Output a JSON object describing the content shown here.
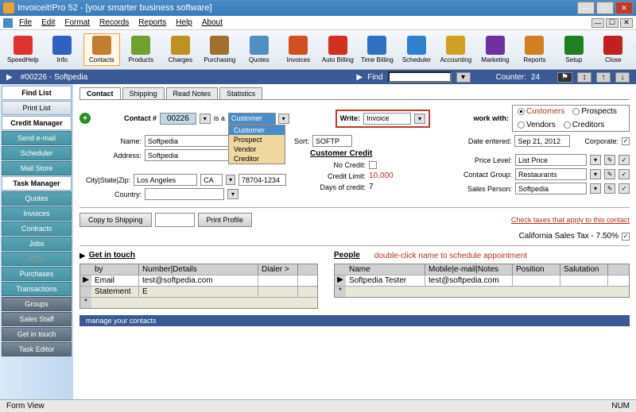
{
  "title": "Invoiceit!Pro 52 - [your smarter business software]",
  "menu": [
    "File",
    "Edit",
    "Format",
    "Records",
    "Reports",
    "Help",
    "About"
  ],
  "toolbar": [
    {
      "label": "SpeedHelp",
      "color": "#e03030"
    },
    {
      "label": "Info",
      "color": "#3060c0"
    },
    {
      "label": "Contacts",
      "color": "#c08030"
    },
    {
      "label": "Products",
      "color": "#70a030"
    },
    {
      "label": "Charges",
      "color": "#c09020"
    },
    {
      "label": "Purchasing",
      "color": "#a07030"
    },
    {
      "label": "Quotes",
      "color": "#5090c0"
    },
    {
      "label": "Invoices",
      "color": "#d05020"
    },
    {
      "label": "Auto Billing",
      "color": "#d03020"
    },
    {
      "label": "Time Billing",
      "color": "#3070c0"
    },
    {
      "label": "Scheduler",
      "color": "#3080d0"
    },
    {
      "label": "Accounting",
      "color": "#d0a020"
    },
    {
      "label": "Marketing",
      "color": "#7030a0"
    },
    {
      "label": "Reports",
      "color": "#d08020"
    },
    {
      "label": "Setup",
      "color": "#208020"
    },
    {
      "label": "Close",
      "color": "#c02020"
    }
  ],
  "context": {
    "record": "#00226 - Softpedia",
    "find_label": "Find",
    "counter_label": "Counter:",
    "counter": "24"
  },
  "sidebar": [
    {
      "label": "Find List",
      "cls": "white"
    },
    {
      "label": "Print List",
      "cls": ""
    },
    {
      "label": "Credit Manager",
      "cls": "white"
    },
    {
      "label": "Send e-mail",
      "cls": "teal"
    },
    {
      "label": "Scheduler",
      "cls": "teal"
    },
    {
      "label": "Mail Store",
      "cls": "teal"
    },
    {
      "label": "Task Manager",
      "cls": "white"
    },
    {
      "label": "Quotes",
      "cls": "teal"
    },
    {
      "label": "Invoices",
      "cls": "teal"
    },
    {
      "label": "Contracts",
      "cls": "teal"
    },
    {
      "label": "Jobs",
      "cls": "teal"
    },
    {
      "label": "P/Os",
      "cls": "teal dim"
    },
    {
      "label": "Purchases",
      "cls": "teal"
    },
    {
      "label": "Transactions",
      "cls": "teal"
    },
    {
      "label": "Groups",
      "cls": "dark"
    },
    {
      "label": "Sales Staff",
      "cls": "dark"
    },
    {
      "label": "Get in touch",
      "cls": "dark"
    },
    {
      "label": "Task Editor",
      "cls": "dark"
    }
  ],
  "tabs": [
    "Contact",
    "Shipping",
    "Read Notes",
    "Statistics"
  ],
  "form": {
    "contact_label": "Contact #",
    "contact_num": "00226",
    "isa_label": "is a",
    "type_selected": "Customer",
    "type_options": [
      "Customer",
      "Prospect",
      "Vendor",
      "Creditor"
    ],
    "write_label": "Write:",
    "write_value": "Invoice",
    "work_label": "work with:",
    "name_label": "Name:",
    "name": "Softpedia",
    "sort_label": "Sort:",
    "sort": "SOFTP",
    "address_label": "Address:",
    "address": "Softpedia",
    "csz_label": "City|State|Zip:",
    "city": "Los Angeles",
    "state": "CA",
    "zip": "78704-1234",
    "country_label": "Country:",
    "date_label": "Date entered:",
    "date": "Sep 21, 2012",
    "corporate_label": "Corporate:",
    "credit_hdr": "Customer Credit",
    "nocredit_label": "No Credit:",
    "limit_label": "Credit Limit:",
    "limit": "10,000",
    "days_label": "Days of credit:",
    "days": "7",
    "pricelevel_label": "Price Level:",
    "pricelevel": "List Price",
    "group_label": "Contact Group:",
    "group": "Restaurants",
    "sales_label": "Sales Person:",
    "sales": "Softpedia",
    "copy_btn": "Copy to Shipping",
    "print_btn": "Print Profile",
    "check_taxes": "Check taxes that apply to this contact",
    "tax_line": "California Sales Tax - 7.50%"
  },
  "workwith": [
    {
      "label": "Customers",
      "on": true,
      "red": true
    },
    {
      "label": "Prospects",
      "on": false
    },
    {
      "label": "Vendors",
      "on": false
    },
    {
      "label": "Creditors",
      "on": false
    }
  ],
  "touch": {
    "hdr": "Get in touch",
    "cols": [
      "by",
      "Number|Details",
      "Dialer >"
    ],
    "rows": [
      [
        "Email",
        "test@softpedia.com",
        ""
      ],
      [
        "Statement",
        "E",
        ""
      ]
    ]
  },
  "people": {
    "hdr": "People",
    "hint": "double-click name to schedule appointment",
    "cols": [
      "Name",
      "Mobile|e-mail|Notes",
      "Position",
      "Salutation"
    ],
    "rows": [
      [
        "Softpedia Tester",
        "test@softpedia.com",
        "",
        ""
      ]
    ]
  },
  "bottom_status": "manage your contacts",
  "statusbar": {
    "left": "Form View",
    "right": "NUM"
  }
}
